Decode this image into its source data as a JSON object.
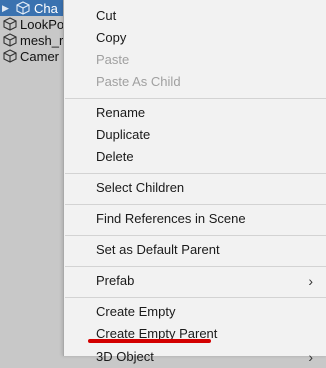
{
  "hierarchy": {
    "items": [
      {
        "label": "Cha",
        "selected": true
      },
      {
        "label": "LookPo",
        "selected": false
      },
      {
        "label": "mesh_r",
        "selected": false
      },
      {
        "label": "Camer",
        "selected": false
      }
    ],
    "expand_icon": "triangle-right",
    "item_icon": "cube-icon"
  },
  "context_menu": {
    "items": {
      "cut": "Cut",
      "copy": "Copy",
      "paste": "Paste",
      "paste_as_child": "Paste As Child",
      "rename": "Rename",
      "duplicate": "Duplicate",
      "delete": "Delete",
      "select_children": "Select Children",
      "find_references": "Find References in Scene",
      "set_default_parent": "Set as Default Parent",
      "prefab": "Prefab",
      "create_empty": "Create Empty",
      "create_empty_parent": "Create Empty Parent",
      "object_3d": "3D Object"
    },
    "submenu_chevron": "›",
    "highlight_color": "#d30000"
  }
}
